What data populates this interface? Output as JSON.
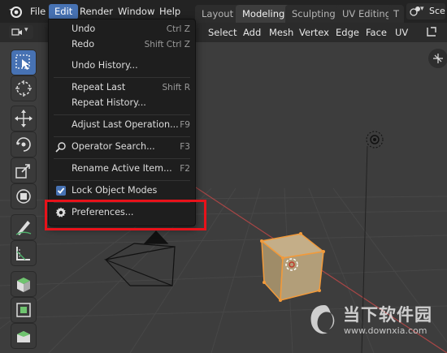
{
  "menubar": {
    "items": [
      "File",
      "Edit",
      "Render",
      "Window",
      "Help"
    ]
  },
  "workspace_tabs": [
    "Layout",
    "Modeling",
    "Sculpting",
    "UV Editing",
    "T"
  ],
  "scene_label": "Sce",
  "header": {
    "buttons": [
      "Select",
      "Add",
      "Mesh",
      "Vertex",
      "Edge",
      "Face",
      "UV"
    ]
  },
  "edit_menu": {
    "items": [
      {
        "label": "Undo",
        "shortcut": "Ctrl Z"
      },
      {
        "label": "Redo",
        "shortcut": "Shift Ctrl Z"
      },
      {
        "label": "Undo History...",
        "shortcut": ""
      },
      {
        "label": "Repeat Last",
        "shortcut": "Shift R"
      },
      {
        "label": "Repeat History...",
        "shortcut": ""
      },
      {
        "label": "Adjust Last Operation...",
        "shortcut": "F9"
      },
      {
        "label": "Operator Search...",
        "shortcut": "F3"
      },
      {
        "label": "Rename Active Item...",
        "shortcut": "F2"
      },
      {
        "label": "Lock Object Modes",
        "shortcut": ""
      },
      {
        "label": "Preferences...",
        "shortcut": ""
      }
    ]
  },
  "watermark": {
    "title": "当下软件园",
    "url": "www.downxia.com"
  },
  "colors": {
    "accent": "#4772b3",
    "highlight_box": "#e8121a",
    "cube": "#b7a27c"
  }
}
